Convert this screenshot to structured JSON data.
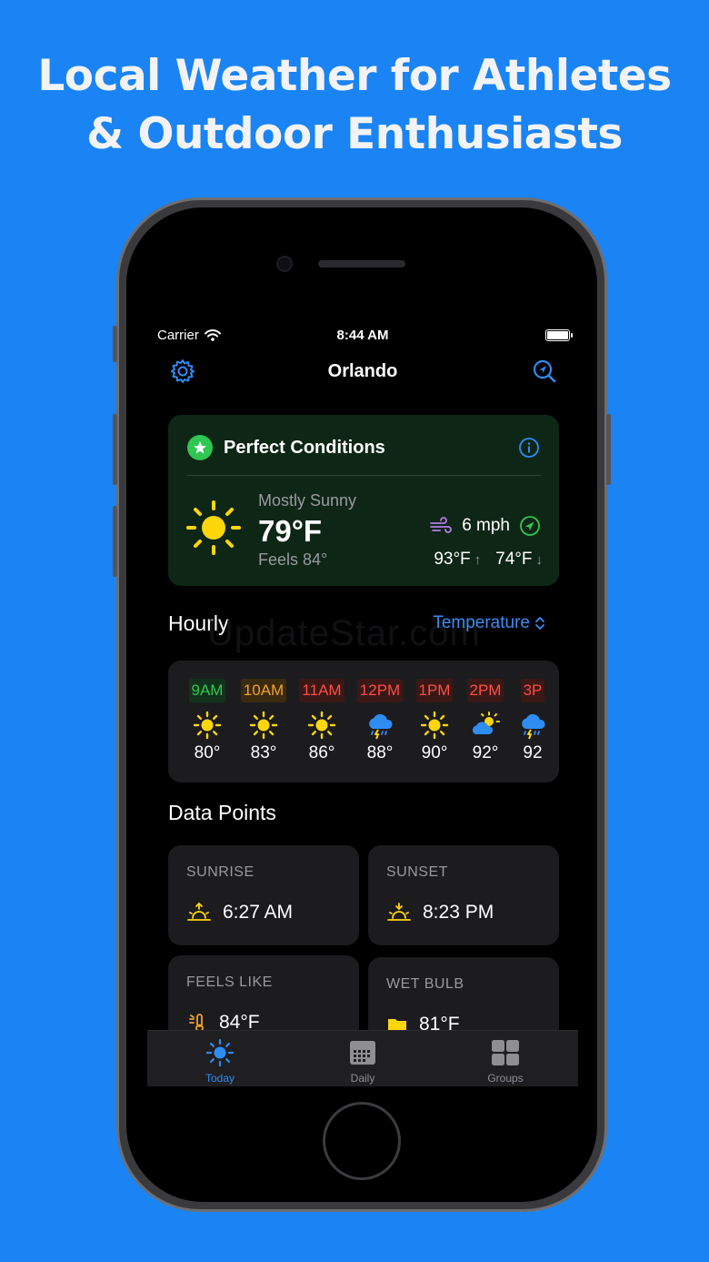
{
  "promo": {
    "line1": "Local Weather for Athletes",
    "line2": "& Outdoor Enthusiasts"
  },
  "status_bar": {
    "carrier": "Carrier",
    "time": "8:44 AM"
  },
  "nav": {
    "title": "Orlando",
    "left_icon": "gear-icon",
    "right_icon": "location-search-icon"
  },
  "conditions": {
    "title": "Perfect Conditions",
    "summary": "Mostly Sunny",
    "temp": "79°F",
    "feels": "Feels 84°",
    "wind": "6 mph",
    "high": "93°F",
    "low": "74°F",
    "accent": "#2fc652"
  },
  "hourly": {
    "title": "Hourly",
    "metric": "Temperature",
    "items": [
      {
        "label": "9AM",
        "temp": "80°",
        "icon": "sun-icon",
        "color": "#2fc652",
        "bg": "#12321c"
      },
      {
        "label": "10AM",
        "temp": "83°",
        "icon": "sun-icon",
        "color": "#f2a12e",
        "bg": "#3a2a10"
      },
      {
        "label": "11AM",
        "temp": "86°",
        "icon": "sun-icon",
        "color": "#ff4d46",
        "bg": "#3a1816"
      },
      {
        "label": "12PM",
        "temp": "88°",
        "icon": "thunderstorm-icon",
        "color": "#ff4d46",
        "bg": "#3a1816"
      },
      {
        "label": "1PM",
        "temp": "90°",
        "icon": "sun-icon",
        "color": "#ff4d46",
        "bg": "#3a1816"
      },
      {
        "label": "2PM",
        "temp": "92°",
        "icon": "partly-cloudy-icon",
        "color": "#ff4d46",
        "bg": "#3a1816"
      },
      {
        "label": "3P",
        "temp": "92",
        "icon": "thunderstorm-icon",
        "color": "#ff4d46",
        "bg": "#3a1816"
      }
    ]
  },
  "data_points": {
    "title": "Data Points",
    "items": [
      {
        "label": "SUNRISE",
        "value": "6:27 AM",
        "icon": "sunrise-icon"
      },
      {
        "label": "SUNSET",
        "value": "8:23 PM",
        "icon": "sunset-icon"
      },
      {
        "label": "FEELS LIKE",
        "value": "84°F",
        "icon": "thermometer-icon"
      },
      {
        "label": "WET BULB",
        "value": "81°F",
        "icon": "folder-icon"
      }
    ]
  },
  "watermark": "UpdateStar.com",
  "tabs": [
    {
      "label": "Today",
      "icon": "sun-icon",
      "active": true
    },
    {
      "label": "Daily",
      "icon": "calendar-icon",
      "active": false
    },
    {
      "label": "Groups",
      "icon": "grid-icon",
      "active": false
    }
  ]
}
